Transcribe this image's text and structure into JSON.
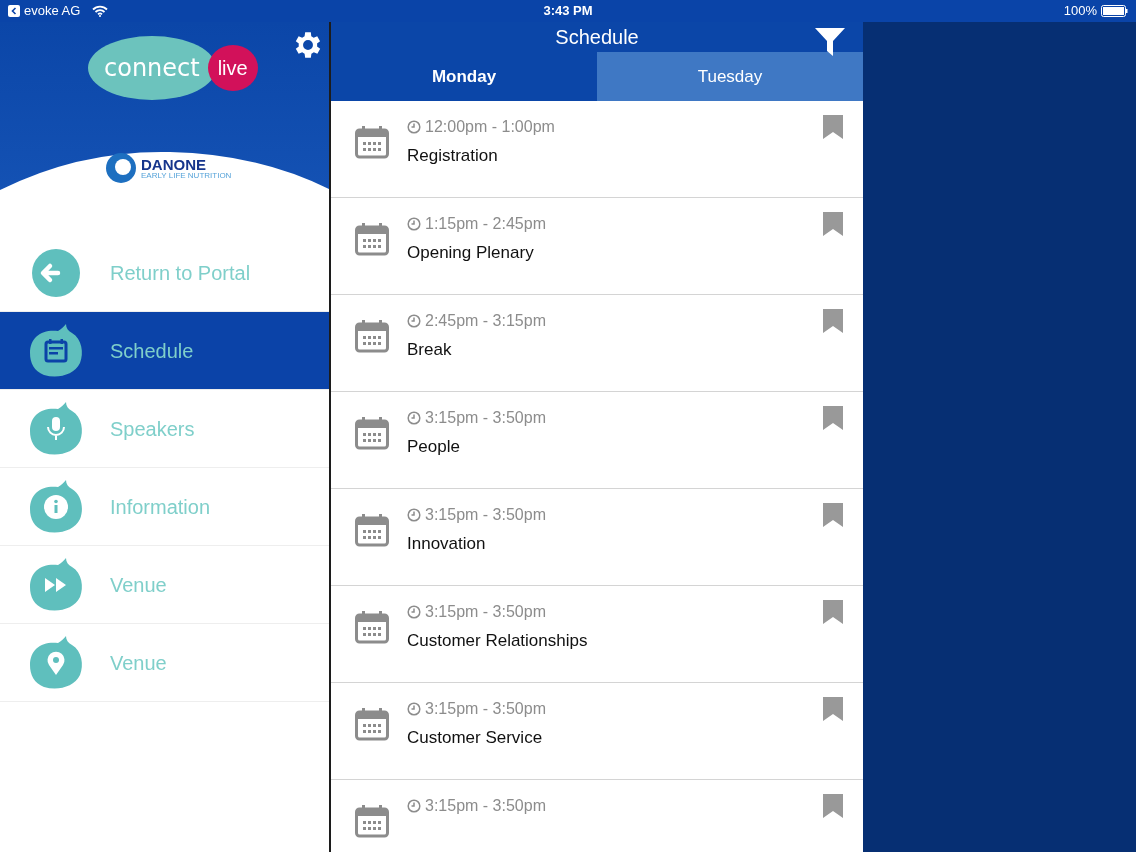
{
  "status_bar": {
    "back_label": "evoke AG",
    "time": "3:43 PM",
    "battery": "100%"
  },
  "sidebar": {
    "logo": {
      "word": "connect",
      "badge": "live"
    },
    "brand": {
      "name": "DANONE",
      "tagline": "EARLY LIFE NUTRITION"
    },
    "items": [
      {
        "kind": "back",
        "label": "Return to Portal",
        "selected": false
      },
      {
        "kind": "calendar",
        "label": "Schedule",
        "selected": true
      },
      {
        "kind": "mic",
        "label": "Speakers",
        "selected": false
      },
      {
        "kind": "info",
        "label": "Information",
        "selected": false
      },
      {
        "kind": "forward",
        "label": "Venue",
        "selected": false
      },
      {
        "kind": "pin",
        "label": "Venue",
        "selected": false
      }
    ]
  },
  "schedule": {
    "title": "Schedule",
    "tabs": [
      {
        "label": "Monday",
        "selected": true
      },
      {
        "label": "Tuesday",
        "selected": false
      }
    ],
    "sessions": [
      {
        "time": "12:00pm - 1:00pm",
        "title": "Registration"
      },
      {
        "time": "1:15pm - 2:45pm",
        "title": "Opening Plenary"
      },
      {
        "time": "2:45pm - 3:15pm",
        "title": "Break"
      },
      {
        "time": "3:15pm - 3:50pm",
        "title": "People"
      },
      {
        "time": "3:15pm - 3:50pm",
        "title": "Innovation"
      },
      {
        "time": "3:15pm - 3:50pm",
        "title": "Customer Relationships"
      },
      {
        "time": "3:15pm - 3:50pm",
        "title": "Customer Service"
      },
      {
        "time": "3:15pm - 3:50pm"
      }
    ]
  }
}
